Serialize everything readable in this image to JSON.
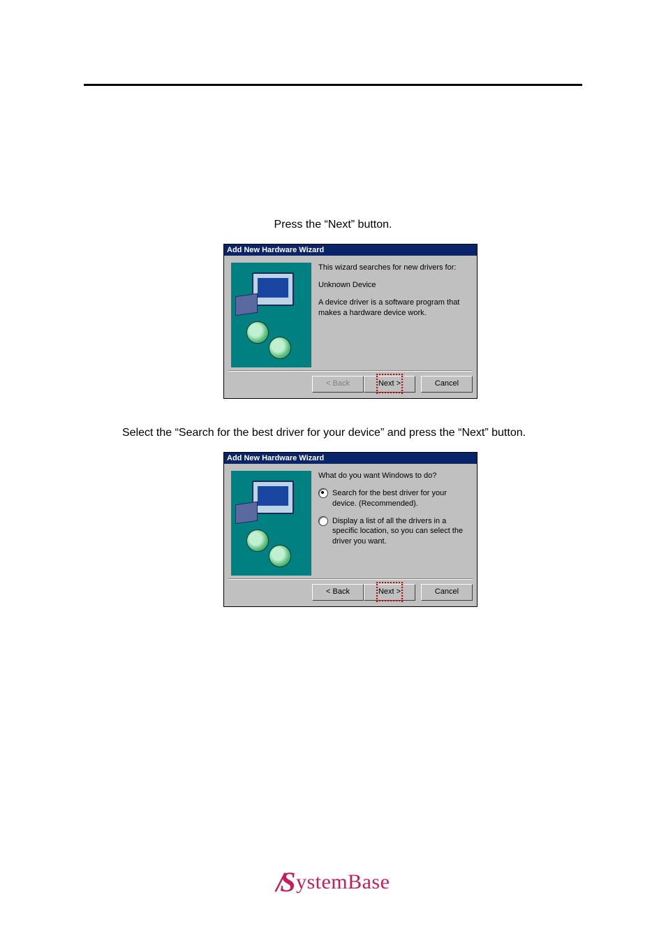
{
  "caption1": "Press the “Next” button.",
  "caption2": "Select the “Search for the best driver for your device” and press the “Next” button.",
  "wizard1": {
    "title": "Add New Hardware Wizard",
    "line1": "This wizard searches for new drivers for:",
    "line2": "Unknown Device",
    "line3": "A device driver is a software program that makes a hardware device work.",
    "back": "< Back",
    "next": "Next >",
    "cancel": "Cancel"
  },
  "wizard2": {
    "title": "Add New Hardware Wizard",
    "question": "What do you want Windows to do?",
    "opt1": "Search for the best driver for your device. (Recommended).",
    "opt2": "Display a list of all the drivers in a specific location, so you can select the driver you want.",
    "back": "< Back",
    "next": "Next >",
    "cancel": "Cancel"
  },
  "footer_brand": "ystemBase"
}
